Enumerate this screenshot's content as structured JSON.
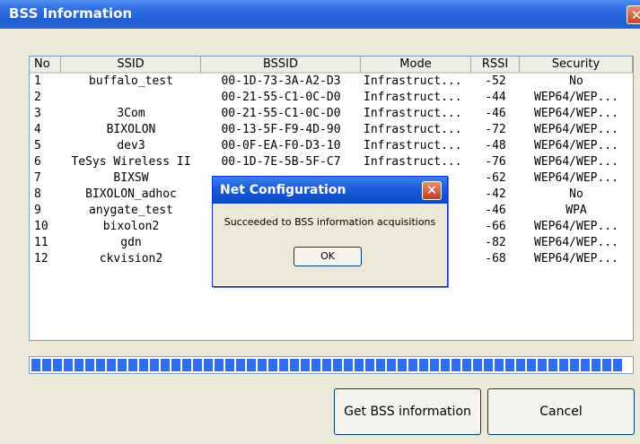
{
  "window": {
    "title": "BSS Information",
    "close_glyph": "✕"
  },
  "columns": [
    "No",
    "SSID",
    "BSSID",
    "Mode",
    "RSSI",
    "Security"
  ],
  "rows": [
    [
      "1",
      "buffalo_test",
      "00-1D-73-3A-A2-D3",
      "Infrastruct...",
      "-52",
      "No"
    ],
    [
      "2",
      "",
      "00-21-55-C1-0C-D0",
      "Infrastruct...",
      "-44",
      "WEP64/WEP..."
    ],
    [
      "3",
      "3Com",
      "00-21-55-C1-0C-D0",
      "Infrastruct...",
      "-46",
      "WEP64/WEP..."
    ],
    [
      "4",
      "BIXOLON",
      "00-13-5F-F9-4D-90",
      "Infrastruct...",
      "-72",
      "WEP64/WEP..."
    ],
    [
      "5",
      "dev3",
      "00-0F-EA-F0-D3-10",
      "Infrastruct...",
      "-48",
      "WEP64/WEP..."
    ],
    [
      "6",
      "TeSys Wireless II",
      "00-1D-7E-5B-5F-C7",
      "Infrastruct...",
      "-76",
      "WEP64/WEP..."
    ],
    [
      "7",
      "BIXSW",
      "",
      "",
      "-62",
      "WEP64/WEP..."
    ],
    [
      "8",
      "BIXOLON_adhoc",
      "",
      "",
      "-42",
      "No"
    ],
    [
      "9",
      "anygate_test",
      "",
      "",
      "-46",
      "WPA"
    ],
    [
      "10",
      "bixolon2",
      "",
      "",
      "-66",
      "WEP64/WEP..."
    ],
    [
      "11",
      "gdn",
      "",
      "",
      "-82",
      "WEP64/WEP..."
    ],
    [
      "12",
      "ckvision2",
      "",
      "",
      "-68",
      "WEP64/WEP..."
    ]
  ],
  "progress": {
    "value": 1.0,
    "color": "#2f6ef2"
  },
  "buttons": {
    "get": "Get BSS information",
    "cancel": "Cancel"
  },
  "dialog": {
    "title": "Net Configuration",
    "message": "Succeeded to BSS information acquisitions",
    "ok": "OK",
    "close_glyph": "✕"
  },
  "colors": {
    "titlebar": "#2f6fe0",
    "dialog_face": "#ece9d8",
    "progress": "#2f6ef2"
  }
}
